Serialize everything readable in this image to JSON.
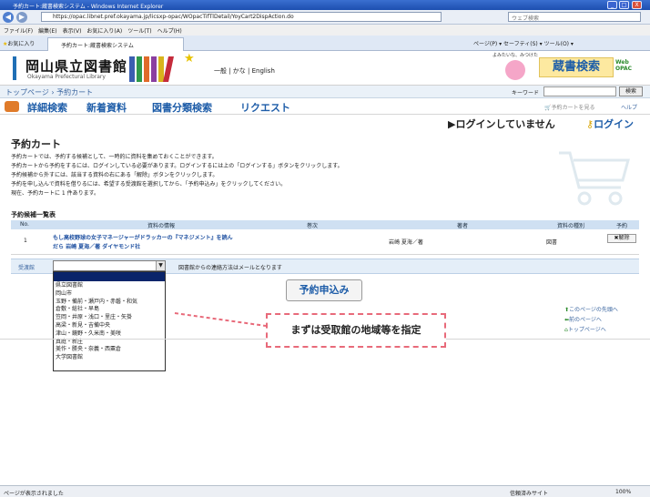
{
  "window": {
    "title": "予約カート:蔵書検索システム - Windows Internet Explorer",
    "controls": [
      "_",
      "□",
      "X"
    ]
  },
  "address": {
    "url": "https://opac.libnet.pref.okayama.jp/licsxp-opac/WOpacTifTlDetail/YoyCart2DispAction.do",
    "websearch_placeholder": "ウェブ検索"
  },
  "menu": [
    "ファイル(F)",
    "編集(E)",
    "表示(V)",
    "お気に入り(A)",
    "ツール(T)",
    "ヘルプ(H)"
  ],
  "favorites": {
    "label": "お気に入り",
    "tab": "予約カート:蔵書検索システム",
    "tools": "ページ(P) ▾  セーフティ(S) ▾  ツール(O) ▾"
  },
  "site": {
    "logo_title": "岡山県立図書館",
    "logo_sub": "Okayama Prefectural Library",
    "lang": "一般 | かな | English",
    "mascot_text": "よみたいな、みつけた",
    "brand": "蔵書検索",
    "brand_sub1": "Web",
    "brand_sub2": "OPAC",
    "breadcrumb": "トップページ › 予約カート",
    "keyword_label": "キーワード",
    "search_button": "検索",
    "nav": [
      "詳細検索",
      "新着資料",
      "図書分類検索",
      "リクエスト"
    ],
    "cart_link": "予約カートを見る",
    "help_link": "ヘルプ",
    "login_status": "ログインしていません",
    "login_link": "ログイン"
  },
  "cart": {
    "title": "予約カート",
    "intro": [
      "予約カートでは、予約する候補として、一時的に資料を集めておくことができます。",
      "予約カートから予約をするには、ログインしている必要があります。ログインするには上の「ログインする」ボタンをクリックします。",
      "予約候補から外すには、該当する資料の右にある「解除」ボタンをクリックします。",
      "予約を申し込んで資料を借りるには、希望する受渡館を選択してから、「予約申込み」をクリックしてください。",
      "現在、予約カートに  1  件あります。"
    ],
    "list_title": "予約候補一覧表",
    "headers": [
      "No.",
      "資料の情報",
      "巻次",
      "著者",
      "資料の種別",
      "予約"
    ],
    "rows": [
      {
        "no": "1",
        "title": "もし高校野球の女子マネージャーがドラッカーの『マネジメント』を読ん",
        "title2": "だら 岩崎 夏海／著 ダイヤモンド社",
        "volume": "",
        "author": "岩崎 夏海／著",
        "type": "図書",
        "action": "✖解除"
      }
    ],
    "pickup_label": "受渡館",
    "contact_note": "図書館からの連絡方法はメールとなります",
    "pickup_options": [
      "県立図書館",
      "岡山市",
      "玉野・備前・瀬戸内・赤磐・和気",
      "倉敷・総社・早島",
      "笠岡・井原・浅口・里庄・矢掛",
      "高梁・新見・吉備中央",
      "津山・鏡野・久米南・美咲",
      "真庭・新庄",
      "美作・勝央・奈義・西粟倉",
      "大学図書館"
    ],
    "submit": "予約申込み",
    "page_links": [
      "このページの先頭へ",
      "前のページへ",
      "トップページへ"
    ]
  },
  "callout": "まずは受取館の地域等を指定",
  "status": {
    "left": "ページが表示されました",
    "zone": "信頼済みサイト",
    "zoom": "100%"
  }
}
